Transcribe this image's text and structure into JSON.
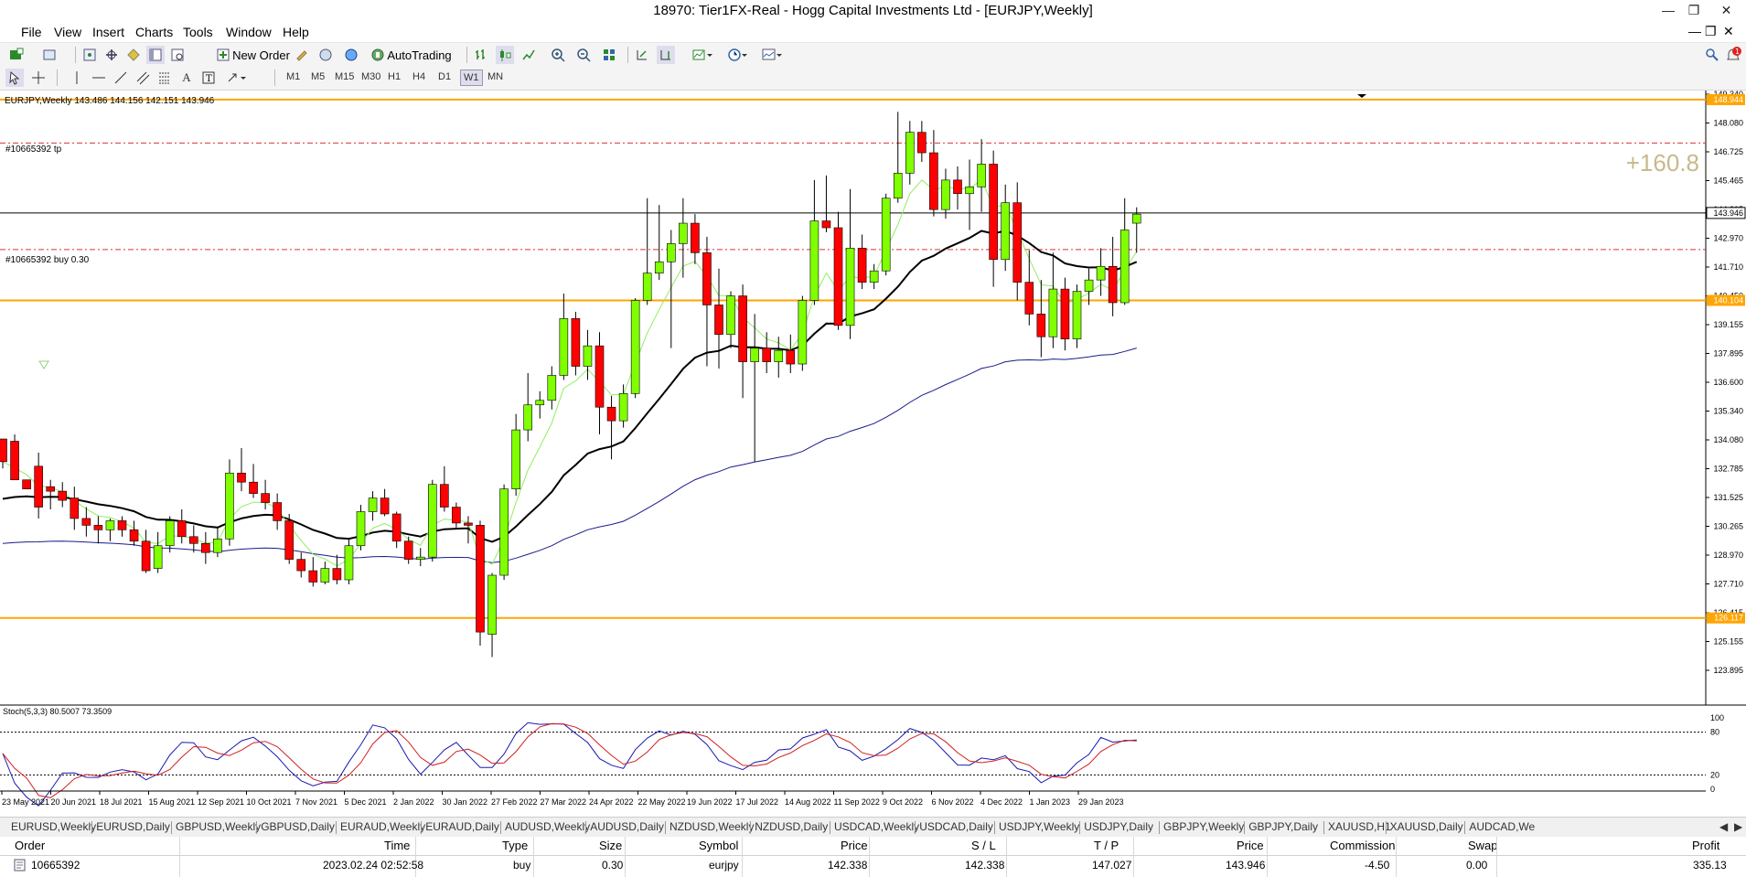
{
  "window": {
    "title": "18970: Tier1FX-Real - Hogg Capital Investments Ltd - [EURJPY,Weekly]"
  },
  "menu": [
    "File",
    "View",
    "Insert",
    "Charts",
    "Tools",
    "Window",
    "Help"
  ],
  "toolbar": {
    "new_order": "New Order",
    "autotrading": "AutoTrading"
  },
  "timeframes": [
    "M1",
    "M5",
    "M15",
    "M30",
    "H1",
    "H4",
    "D1",
    "W1",
    "MN"
  ],
  "chart": {
    "header": "EURJPY,Weekly  143.486 144.156 142.151 143.946",
    "tp_label": "#10665392 tp",
    "buy_label": "#10665392 buy 0.30",
    "profit_overlay": "+160.8",
    "price_labels": [
      "149.340",
      "148.080",
      "146.725",
      "145.465",
      "144.205",
      "142.970",
      "141.710",
      "140.450",
      "139.155",
      "137.895",
      "136.600",
      "135.340",
      "134.080",
      "132.785",
      "131.525",
      "130.265",
      "128.970",
      "127.710",
      "126.415",
      "125.155",
      "123.895"
    ],
    "current_price": "143.946",
    "level_top": "148.944",
    "level_mid": "140.104",
    "level_low": "126.117",
    "date_labels": [
      "23 May 2021",
      "20 Jun 2021",
      "18 Jul 2021",
      "15 Aug 2021",
      "12 Sep 2021",
      "10 Oct 2021",
      "7 Nov 2021",
      "5 Dec 2021",
      "2 Jan 2022",
      "30 Jan 2022",
      "27 Feb 2022",
      "27 Mar 2022",
      "24 Apr 2022",
      "22 May 2022",
      "19 Jun 2022",
      "17 Jul 2022",
      "14 Aug 2022",
      "11 Sep 2022",
      "9 Oct 2022",
      "6 Nov 2022",
      "4 Dec 2022",
      "1 Jan 2023",
      "29 Jan 2023"
    ],
    "stoch_label": "Stoch(5,3,3) 80.5007 73.3509",
    "stoch_levels": [
      "100",
      "80",
      "20",
      "0"
    ],
    "colors": {
      "bull": "#80ff00",
      "bear": "#ff0000",
      "level": "#ffa500",
      "tpline": "#d33",
      "ma_fast": "#90ee60",
      "ma_mid": "#000000",
      "ma_slow": "#1a1a8c",
      "stoch_main": "#1a1ab0",
      "stoch_signal": "#d02020",
      "profit": "#c8b98a"
    }
  },
  "chart_data": {
    "type": "candlestick",
    "symbol": "EURJPY",
    "timeframe": "Weekly",
    "ylim": [
      123.895,
      149.34
    ],
    "candles": [
      [
        134.0,
        133.3,
        132.7,
        133.0
      ],
      [
        133.9,
        134.2,
        133.6,
        132.2
      ],
      [
        132.2,
        132.6,
        132.6,
        131.8
      ],
      [
        132.8,
        133.4,
        130.5,
        131.0
      ],
      [
        131.9,
        132.2,
        130.9,
        131.7
      ],
      [
        131.7,
        132.1,
        131.0,
        131.3
      ],
      [
        131.4,
        131.9,
        130.0,
        130.5
      ],
      [
        130.5,
        131.0,
        129.7,
        130.2
      ],
      [
        130.2,
        130.6,
        129.4,
        130.0
      ],
      [
        130.0,
        130.5,
        129.5,
        130.4
      ],
      [
        130.4,
        130.6,
        129.7,
        130.0
      ],
      [
        130.0,
        130.4,
        129.3,
        129.5
      ],
      [
        129.5,
        130.0,
        128.1,
        128.2
      ],
      [
        128.3,
        129.9,
        128.1,
        129.3
      ],
      [
        129.3,
        130.6,
        129.0,
        130.4
      ],
      [
        130.4,
        130.9,
        129.4,
        129.7
      ],
      [
        129.7,
        130.2,
        129.0,
        129.4
      ],
      [
        129.4,
        129.9,
        128.5,
        129.0
      ],
      [
        129.0,
        130.1,
        128.8,
        129.6
      ],
      [
        129.6,
        133.1,
        129.3,
        132.5
      ],
      [
        132.5,
        133.6,
        131.7,
        132.1
      ],
      [
        132.1,
        132.9,
        131.4,
        131.6
      ],
      [
        131.6,
        132.2,
        130.9,
        131.2
      ],
      [
        131.2,
        131.6,
        130.0,
        130.4
      ],
      [
        130.4,
        130.7,
        128.5,
        128.7
      ],
      [
        128.7,
        129.0,
        127.9,
        128.2
      ],
      [
        128.2,
        128.8,
        127.5,
        127.7
      ],
      [
        127.7,
        128.6,
        127.6,
        128.3
      ],
      [
        128.3,
        128.9,
        127.6,
        127.8
      ],
      [
        127.8,
        129.6,
        127.6,
        129.3
      ],
      [
        129.3,
        131.1,
        129.1,
        130.8
      ],
      [
        130.8,
        131.7,
        130.4,
        131.4
      ],
      [
        131.4,
        131.8,
        130.6,
        130.7
      ],
      [
        130.7,
        130.8,
        129.2,
        129.5
      ],
      [
        129.5,
        129.7,
        128.5,
        128.7
      ],
      [
        128.7,
        129.2,
        128.4,
        128.8
      ],
      [
        128.8,
        132.2,
        128.6,
        132.0
      ],
      [
        132.0,
        132.8,
        130.8,
        131.0
      ],
      [
        131.0,
        131.2,
        130.1,
        130.3
      ],
      [
        130.3,
        130.6,
        129.4,
        130.2
      ],
      [
        130.2,
        130.4,
        124.9,
        125.5
      ],
      [
        125.4,
        128.1,
        124.4,
        128.0
      ],
      [
        128.0,
        132.0,
        127.8,
        131.8
      ],
      [
        131.8,
        135.1,
        131.5,
        134.4
      ],
      [
        134.4,
        136.9,
        133.9,
        135.5
      ],
      [
        135.5,
        136.1,
        134.9,
        135.7
      ],
      [
        135.7,
        137.2,
        135.3,
        136.8
      ],
      [
        136.8,
        140.4,
        136.6,
        139.3
      ],
      [
        139.3,
        139.6,
        136.8,
        137.2
      ],
      [
        137.2,
        138.8,
        136.6,
        138.1
      ],
      [
        138.1,
        138.7,
        134.2,
        135.4
      ],
      [
        135.4,
        135.9,
        133.1,
        134.8
      ],
      [
        134.8,
        136.4,
        134.5,
        136.0
      ],
      [
        136.0,
        140.2,
        135.8,
        140.1
      ],
      [
        140.1,
        144.6,
        139.9,
        141.3
      ],
      [
        141.3,
        144.3,
        141.0,
        141.8
      ],
      [
        141.8,
        143.2,
        138.0,
        142.6
      ],
      [
        142.6,
        144.6,
        141.1,
        143.5
      ],
      [
        143.5,
        143.9,
        141.7,
        142.2
      ],
      [
        142.2,
        142.9,
        137.2,
        139.9
      ],
      [
        139.9,
        141.5,
        137.1,
        138.6
      ],
      [
        138.6,
        140.5,
        138.0,
        140.3
      ],
      [
        140.3,
        140.8,
        135.8,
        137.4
      ],
      [
        137.4,
        139.5,
        133.0,
        138.0
      ],
      [
        138.0,
        138.7,
        136.9,
        137.4
      ],
      [
        137.4,
        138.5,
        136.7,
        137.9
      ],
      [
        137.9,
        138.6,
        136.9,
        137.3
      ],
      [
        137.3,
        140.3,
        137.0,
        140.1
      ],
      [
        140.1,
        145.4,
        139.9,
        143.6
      ],
      [
        143.6,
        145.6,
        143.1,
        143.3
      ],
      [
        143.3,
        144.0,
        138.8,
        139.0
      ],
      [
        139.0,
        145.0,
        138.4,
        142.4
      ],
      [
        142.4,
        143.0,
        140.6,
        140.9
      ],
      [
        140.9,
        141.7,
        140.6,
        141.4
      ],
      [
        141.4,
        144.8,
        141.2,
        144.6
      ],
      [
        144.6,
        148.4,
        144.4,
        145.7
      ],
      [
        145.7,
        148.0,
        145.2,
        147.5
      ],
      [
        147.5,
        148.0,
        146.2,
        146.6
      ],
      [
        146.6,
        147.6,
        143.8,
        144.1
      ],
      [
        144.1,
        145.9,
        143.7,
        145.4
      ],
      [
        145.4,
        146.0,
        144.1,
        144.8
      ],
      [
        144.8,
        146.3,
        143.2,
        145.1
      ],
      [
        145.1,
        147.2,
        144.0,
        146.1
      ],
      [
        146.1,
        146.7,
        140.7,
        141.9
      ],
      [
        141.9,
        145.2,
        141.4,
        144.4
      ],
      [
        144.4,
        145.3,
        140.1,
        140.9
      ],
      [
        140.9,
        142.3,
        139.0,
        139.5
      ],
      [
        139.5,
        141.0,
        137.6,
        138.5
      ],
      [
        138.5,
        142.2,
        138.0,
        140.6
      ],
      [
        140.6,
        141.1,
        137.9,
        138.4
      ],
      [
        138.4,
        140.8,
        138.0,
        140.5
      ],
      [
        140.5,
        141.5,
        139.9,
        141.0
      ],
      [
        141.0,
        142.4,
        140.3,
        141.6
      ],
      [
        141.6,
        142.9,
        139.4,
        140.0
      ],
      [
        140.0,
        144.6,
        139.9,
        143.2
      ],
      [
        143.5,
        144.2,
        142.2,
        143.9
      ]
    ]
  },
  "tabs": [
    "EURUSD,Weekly",
    "EURUSD,Daily",
    "GBPUSD,Weekly",
    "GBPUSD,Daily",
    "EURAUD,Weekly",
    "EURAUD,Daily",
    "AUDUSD,Weekly",
    "AUDUSD,Daily",
    "NZDUSD,Weekly",
    "NZDUSD,Daily",
    "USDCAD,Weekly",
    "USDCAD,Daily",
    "USDJPY,Weekly",
    "USDJPY,Daily",
    "GBPJPY,Weekly",
    "GBPJPY,Daily",
    "XAUUSD,H1",
    "XAUUSD,Daily",
    "AUDCAD,We"
  ],
  "terminal": {
    "headers": {
      "order": "Order",
      "time": "Time",
      "type": "Type",
      "size": "Size",
      "symbol": "Symbol",
      "price": "Price",
      "sl": "S / L",
      "tp": "T / P",
      "price2": "Price",
      "commission": "Commission",
      "swap": "Swap",
      "profit": "Profit"
    },
    "row": {
      "order": "10665392",
      "time": "2023.02.24 02:52:58",
      "type": "buy",
      "size": "0.30",
      "symbol": "eurjpy",
      "price": "142.338",
      "sl": "142.338",
      "tp": "147.027",
      "price2": "143.946",
      "commission": "-4.50",
      "swap": "0.00",
      "profit": "335.13"
    }
  }
}
